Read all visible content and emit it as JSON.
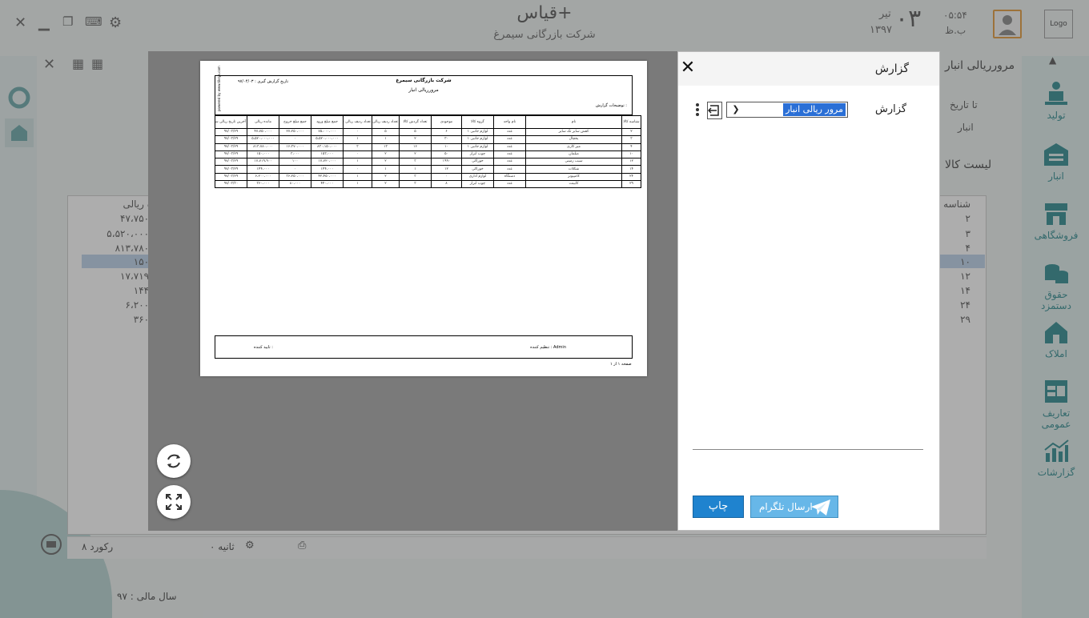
{
  "app": {
    "title": "قیاس+",
    "company": "شرکت بازرگانی سیمرغ",
    "time": "۰۵:۵۴",
    "ampm": "ب.ظ",
    "day": "۰۳",
    "month": "تیر",
    "year": "۱۳۹۷",
    "logo": "Logo"
  },
  "sidebar": {
    "items": [
      {
        "label": "تولید",
        "icon": "production-icon"
      },
      {
        "label": "انبار",
        "icon": "warehouse-icon"
      },
      {
        "label": "فروشگاهی",
        "icon": "store-icon"
      },
      {
        "label": "حقوق دستمزد",
        "icon": "coins-icon"
      },
      {
        "label": "املاک",
        "icon": "house-icon"
      },
      {
        "label": "تعاریف عمومی",
        "icon": "table-icon"
      },
      {
        "label": "گزارشات",
        "icon": "chart-icon"
      }
    ]
  },
  "content": {
    "title": "مرورریالی انبار",
    "list_title": "لیست کالا",
    "filter_to_date": "تا تاریخ",
    "filter_store": "انبار",
    "column_id": "شناسه",
    "column_value": "ه ریالی",
    "values": [
      "۴۷،۷۵۰،",
      "۵،۵۲۰،۰۰۰،",
      "۸۱۳،۷۸۰،",
      "۱۵۰،",
      "۱۷،۷۱۹،",
      "۱۴۴،",
      "۶،۲۰۰،",
      "۳۶۰،"
    ],
    "ids": [
      "۲",
      "۳",
      "۴",
      "۱۰",
      "۱۲",
      "۱۴",
      "۲۴",
      "۲۹"
    ],
    "records": "۸ رکورد",
    "seconds": "۰ ثانیه",
    "fiscal_year": "سال مالی : ۹۷"
  },
  "paper": {
    "company": "شرکت بازرگانی سیمرغ",
    "title": "مرورریالی انبار",
    "date_label": "تاریخ گزارش گیری : ۹۷/۰۴/۰۳",
    "criteria": "توضیحات گزارش :",
    "powered": "powered by www.tiksys.com",
    "headers": [
      "شناسه کالا",
      "نام",
      "نام واحد",
      "گروه کالا",
      "موجودی",
      "تعداد گردش کالا",
      "تعداد ردیف ریالی نشده",
      "تعداد ردیف ریالی نشده",
      "جمع مبلغ ورود",
      "جمع مبلغ خروج",
      "مانده ریالی",
      "آخرین تاریخ ریالی شده"
    ],
    "rows": [
      [
        "۲",
        "کفش سایز تک سایز",
        "عدد",
        "لوازم جانبی ۱",
        "۶",
        "۵",
        "۵",
        "۰",
        "۷۵،۰۰۰،۰۰۰",
        "۲۷،۲۵۰،۰۰۰",
        "۴۷،۷۵۰،۰۰۰",
        "۹۷/۰۳/۲۹"
      ],
      [
        "۳",
        "یخچال",
        "عدد",
        "لوازم جانبی ۱",
        "۳۰",
        "۲",
        "۱",
        "۱",
        "۵،۵۲۰،۰۰۰،۰۰۰",
        "۰",
        "۵،۵۲۰،۰۰۰،۰۰۰",
        "۹۷/۰۳/۲۹"
      ],
      [
        "۴",
        "میز کاری",
        "عدد",
        "لوازم جانبی ۱",
        "۱۰",
        "۱۶",
        "۱۳",
        "۳",
        "۸۳۰،۱۵۰،۰۰۰",
        "۱۶،۳۷۰،۰۰۰",
        "۸۱۳،۷۸۰،۰۰۰",
        "۹۷/۰۳/۲۹"
      ],
      [
        "۱۰",
        "مبلمان",
        "عدد",
        "چوب ابزار",
        "۵۰",
        "۲",
        "۲",
        "۰",
        "۱۵۳،۰۰۰",
        "۳،۰۰۰",
        "۱۵۰،۰۰۰",
        "۹۷/۰۳/۲۹"
      ],
      [
        "۱۲",
        "سیب زمینی",
        "عدد",
        "خوراکی",
        "۱۹۹۰",
        "۳",
        "۲",
        "۱",
        "۱۷،۷۲۰،۰۰۰",
        "۱۰۰",
        "۱۷،۷۱۹،۹۰۰",
        "۹۷/۰۳/۲۹"
      ],
      [
        "۱۴",
        "شکلات",
        "عدد",
        "خوراکی",
        "۱۲",
        "۱",
        "۱",
        "۰",
        "۱۴۴،۰۰۰",
        "۰",
        "۱۴۴،۰۰۰",
        "۹۷/۰۳/۲۹"
      ],
      [
        "۲۴",
        "کامپیوتر",
        "دستگاه",
        "لوازم اداری",
        "۰",
        "۳",
        "۲",
        "۱",
        "۴۲،۴۵۰،۰۰۰",
        "۳۶،۲۵۰،۰۰۰",
        "۶،۲۰۰،۰۰۰",
        "۹۷/۰۳/۲۹"
      ],
      [
        "۲۹",
        "کابینت",
        "عدد",
        "چوب ابزار",
        "۸",
        "۳",
        "۲",
        "۱",
        "۴۴۰،۰۰۰",
        "۸۰،۰۰۰",
        "۳۶۰،۰۰۰",
        "۹۷/۰۳/۳۰"
      ]
    ],
    "footer_user": "تنظیم کننده : Admin",
    "footer_sign": "تایید کننده :",
    "page": "صفحه ۱ از ۱"
  },
  "dialog": {
    "title": "گزارش",
    "field_label": "گزارش",
    "selected_report": "مرور ریالی انبار",
    "print_label": "چاپ",
    "telegram_label": "ارسال تلگرام"
  }
}
